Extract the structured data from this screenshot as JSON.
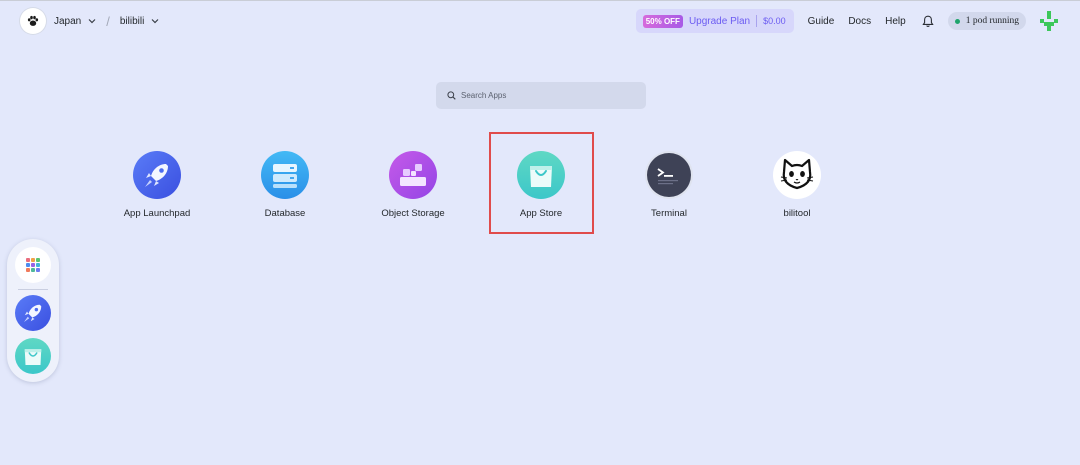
{
  "topbar": {
    "region": "Japan",
    "workspace": "bilibili",
    "plan": {
      "badge": "50% OFF",
      "label": "Upgrade Plan",
      "price": "$0.00"
    },
    "links": [
      "Guide",
      "Docs",
      "Help"
    ],
    "pods_status": "1 pod running",
    "icons": {
      "logo": "paw-logo-icon",
      "bell": "bell-icon",
      "avatar": "pixel-avatar-icon"
    }
  },
  "search": {
    "placeholder": "Search Apps",
    "value": ""
  },
  "apps": [
    {
      "label": "App Launchpad",
      "icon": "rocket-icon"
    },
    {
      "label": "Database",
      "icon": "database-icon"
    },
    {
      "label": "Object Storage",
      "icon": "object-storage-icon"
    },
    {
      "label": "App Store",
      "icon": "shopping-bag-icon"
    },
    {
      "label": "Terminal",
      "icon": "terminal-icon"
    },
    {
      "label": "bilitool",
      "icon": "cat-icon"
    }
  ],
  "dock": {
    "items": [
      "apps-grid-icon",
      "rocket-icon",
      "shopping-bag-icon"
    ]
  },
  "colors": {
    "background": "#e3e8fb",
    "accent": "#6c5cf2",
    "highlight_border": "#e04b4b",
    "status_green": "#1ea46c"
  }
}
